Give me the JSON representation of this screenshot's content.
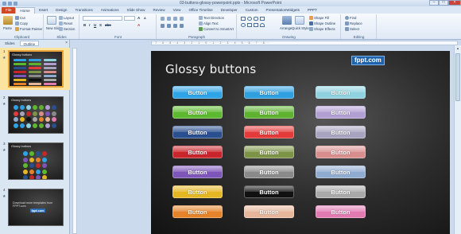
{
  "window": {
    "title": "03-buttons-glossy-powerpoint.pptx - Microsoft PowerPoint"
  },
  "ribbon_tabs": [
    "File",
    "Home",
    "Insert",
    "Design",
    "Transitions",
    "Animations",
    "Slide Show",
    "Review",
    "View",
    "Office Timeline",
    "Developer",
    "Custom",
    "PresentationWidgets",
    "PPPT"
  ],
  "ribbon": {
    "clipboard": {
      "label": "Clipboard",
      "paste": "Paste",
      "cut": "Cut",
      "copy": "Copy",
      "format_painter": "Format Painter"
    },
    "slides": {
      "label": "Slides",
      "new_slide": "New Slide",
      "layout": "Layout",
      "reset": "Reset",
      "section": "Section"
    },
    "font": {
      "label": "Font",
      "font_name": "",
      "font_size": ""
    },
    "paragraph": {
      "label": "Paragraph",
      "text_direction": "Text Direction",
      "align_text": "Align Text",
      "smartart": "Convert to SmartArt"
    },
    "drawing": {
      "label": "Drawing",
      "arrange": "Arrange",
      "quick_styles": "Quick Styles",
      "shape_fill": "Shape Fill",
      "shape_outline": "Shape Outline",
      "shape_effects": "Shape Effects"
    },
    "editing": {
      "label": "Editing",
      "find": "Find",
      "replace": "Replace",
      "select": "Select"
    }
  },
  "left_pane": {
    "tabs": [
      "Slides",
      "Outline"
    ],
    "close": "×",
    "thumbnails": [
      {
        "number": "1",
        "title": "Glossy buttons"
      },
      {
        "number": "2",
        "title": "Glossy buttons"
      },
      {
        "number": "3",
        "title": "Glossy buttons"
      },
      {
        "number": "4",
        "title": "Download more templates from FPPT.com",
        "logo": "fppt.com"
      }
    ]
  },
  "ruler_text": "· · 7 · · · 6 · · · 5 · · · 4 · · · 3 · · · 2 · · · 1 · · · 0 · · · 1 · · · 2 · · · 3 · · · 4 · · · 5 · · · 6 · · · 7 · · · 8 · · ·",
  "slide": {
    "title": "Glossy buttons",
    "logo": "fppt.com",
    "buttons": [
      {
        "label": "Button",
        "color": "#2ea3e6"
      },
      {
        "label": "Button",
        "color": "#2f9fe0"
      },
      {
        "label": "Button",
        "color": "#8fd1df"
      },
      {
        "label": "Button",
        "color": "#5cb82e"
      },
      {
        "label": "Button",
        "color": "#5fb230"
      },
      {
        "label": "Button",
        "color": "#b19ed3"
      },
      {
        "label": "Button",
        "color": "#2a4f8f"
      },
      {
        "label": "Button",
        "color": "#e33a3a"
      },
      {
        "label": "Button",
        "color": "#a8a4bf"
      },
      {
        "label": "Button",
        "color": "#c8262b"
      },
      {
        "label": "Button",
        "color": "#7d9447"
      },
      {
        "label": "Button",
        "color": "#d98e8e"
      },
      {
        "label": "Button",
        "color": "#7e55b8"
      },
      {
        "label": "Button",
        "color": "#8a8a8a"
      },
      {
        "label": "Button",
        "color": "#90abd0"
      },
      {
        "label": "Button",
        "color": "#e5b624"
      },
      {
        "label": "Button",
        "color": "#111111"
      },
      {
        "label": "Button",
        "color": "#a9a9a9"
      },
      {
        "label": "Button",
        "color": "#e4832a"
      },
      {
        "label": "Button",
        "color": "#e7b69a"
      },
      {
        "label": "Button",
        "color": "#e27ab2"
      }
    ]
  }
}
